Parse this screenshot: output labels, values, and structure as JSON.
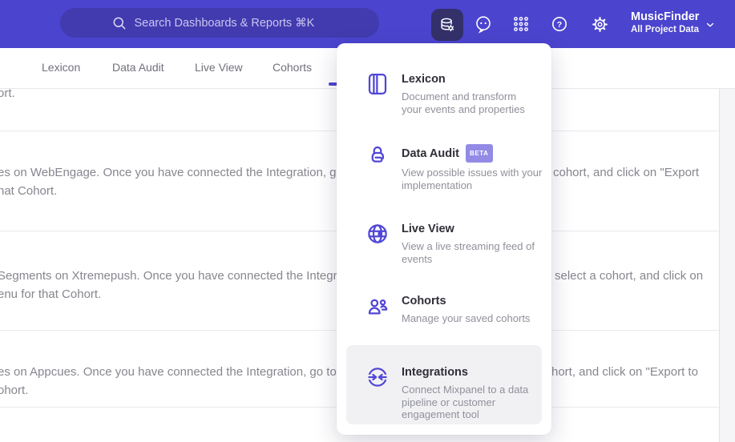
{
  "colors": {
    "accent": "#4c44cf",
    "header_bg": "#4b44ce",
    "search_bg": "#423bb0",
    "active_tool_bg": "#34306a",
    "beta_badge_bg": "#938ae6",
    "highlight_bg": "#f1f1f4"
  },
  "header": {
    "search_placeholder": "Search Dashboards & Reports ⌘K",
    "project_name": "MusicFinder",
    "project_scope": "All Project Data"
  },
  "nav": {
    "tabs": [
      {
        "label": "Lexicon"
      },
      {
        "label": "Data Audit"
      },
      {
        "label": "Live View"
      },
      {
        "label": "Cohorts"
      }
    ]
  },
  "menu": {
    "items": [
      {
        "title": "Lexicon",
        "desc": "Document and transform your events and properties"
      },
      {
        "title": "Data Audit",
        "badge": "BETA",
        "desc": "View possible issues with your implementation"
      },
      {
        "title": "Live View",
        "desc": "View a live streaming feed of events"
      },
      {
        "title": "Cohorts",
        "desc": "Manage your saved cohorts"
      },
      {
        "title": "Integrations",
        "desc": "Connect Mixpanel to a data pipeline or customer engagement tool"
      }
    ]
  },
  "content": {
    "rows": [
      {
        "line1_left": "ort."
      },
      {
        "line1_left": "es on WebEngage. Once you have connected the Integration, go to the",
        "line1_right": "cohort, and click on \"Export",
        "line2": "hat Cohort."
      },
      {
        "line1_left": "Segments on Xtremepush. Once you have connected the Integration,",
        "line1_right": "select a cohort, and click on",
        "line2": "enu for that Cohort."
      },
      {
        "line1_left": "es on Appcues. Once you have connected the Integration, go to the M",
        "line1_right": "hort, and click on \"Export to",
        "line2": "ohort."
      }
    ]
  }
}
